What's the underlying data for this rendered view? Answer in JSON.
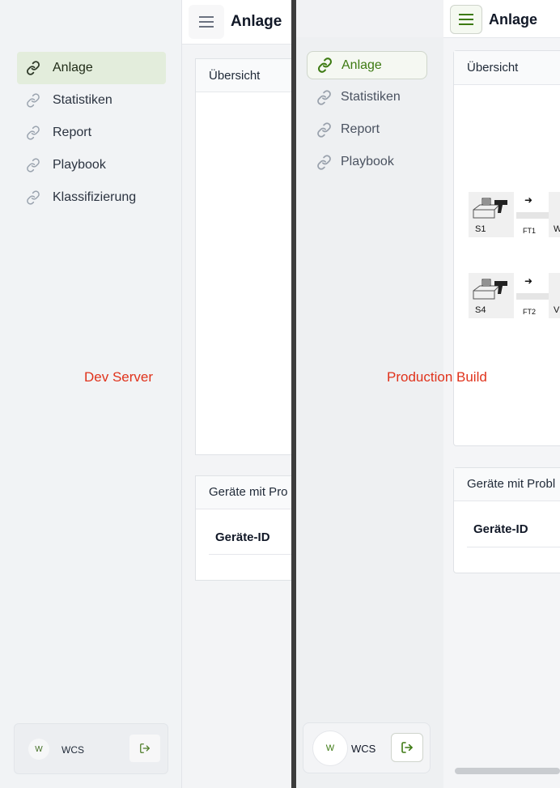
{
  "dev": {
    "label": "Dev Server",
    "title": "Anlage",
    "nav": [
      "Anlage",
      "Statistiken",
      "Report",
      "Playbook",
      "Klassifizierung"
    ],
    "active_nav": "Anlage",
    "overview_title": "Übersicht",
    "devices_title": "Geräte mit Pro",
    "devices_column": "Geräte-ID",
    "user": {
      "avatar": "W",
      "name": "WCS"
    }
  },
  "prod": {
    "label": "Production Build",
    "title": "Anlage",
    "nav": [
      "Anlage",
      "Statistiken",
      "Report",
      "Playbook"
    ],
    "active_nav": "Anlage",
    "overview_title": "Übersicht",
    "devices_title": "Geräte mit Probl",
    "devices_column": "Geräte-ID",
    "user": {
      "avatar": "W",
      "name": "WCS"
    },
    "diagram": {
      "row1": {
        "scanner": "S1",
        "conveyor": "FT1",
        "next": "W"
      },
      "row2": {
        "scanner": "S4",
        "conveyor": "FT2",
        "next": "V"
      }
    }
  },
  "colors": {
    "accent_green": "#3d7a12",
    "active_bg_dev": "#e3eddc",
    "label_red": "#e0321b"
  },
  "icons": {
    "nav": "link-icon",
    "menu": "hamburger-menu-icon",
    "logout": "logout-icon",
    "scanner": "barcode-scanner-icon",
    "direction": "arrow-right-icon"
  }
}
